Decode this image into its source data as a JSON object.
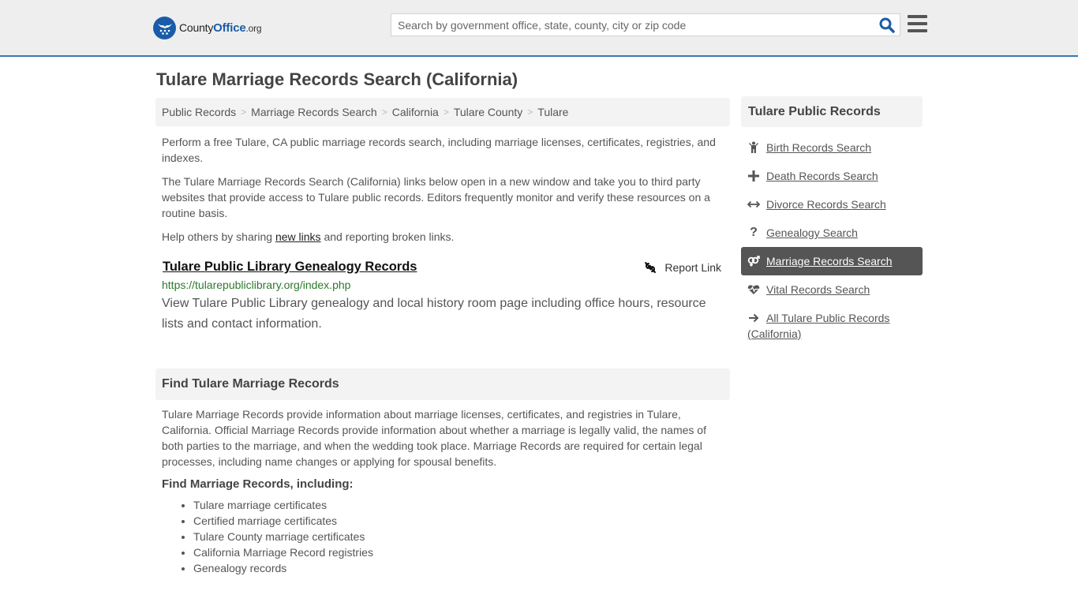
{
  "header": {
    "logo": {
      "name_main": "County",
      "name_accent": "Office",
      "tld": ".org"
    },
    "search": {
      "placeholder": "Search by government office, state, county, city or zip code",
      "value": ""
    },
    "icons": {
      "search": "search-icon",
      "menu": "hamburger-menu-icon"
    }
  },
  "page": {
    "title": "Tulare Marriage Records Search (California)"
  },
  "breadcrumb": [
    {
      "label": "Public Records"
    },
    {
      "label": "Marriage Records Search"
    },
    {
      "label": "California"
    },
    {
      "label": "Tulare County"
    },
    {
      "label": "Tulare"
    }
  ],
  "breadcrumb_separator": ">",
  "intro": {
    "p1": "Perform a free Tulare, CA public marriage records search, including marriage licenses, certificates, registries, and indexes.",
    "p2": "The Tulare Marriage Records Search (California) links below open in a new window and take you to third party websites that provide access to Tulare public records. Editors frequently monitor and verify these resources on a routine basis.",
    "p3_before": "Help others by sharing ",
    "p3_link": "new links",
    "p3_after": " and reporting broken links."
  },
  "result": {
    "title": "Tulare Public Library Genealogy Records",
    "url": "https://tularepubliclibrary.org/index.php",
    "description": "View Tulare Public Library genealogy and local history room page including office hours, resource lists and contact information.",
    "report_label": "Report Link"
  },
  "find_section": {
    "heading": "Find Tulare Marriage Records",
    "body": "Tulare Marriage Records provide information about marriage licenses, certificates, and registries in Tulare, California. Official Marriage Records provide information about whether a marriage is legally valid, the names of both parties to the marriage, and when the wedding took place. Marriage Records are required for certain legal processes, including name changes or applying for spousal benefits.",
    "subheading": "Find Marriage Records, including:",
    "items": [
      "Tulare marriage certificates",
      "Certified marriage certificates",
      "Tulare County marriage certificates",
      "California Marriage Record registries",
      "Genealogy records"
    ]
  },
  "sidebar": {
    "heading": "Tulare Public Records",
    "items": [
      {
        "label": "Birth Records Search",
        "icon": "child-icon",
        "active": false
      },
      {
        "label": "Death Records Search",
        "icon": "plus-icon",
        "active": false
      },
      {
        "label": "Divorce Records Search",
        "icon": "arrows-horizontal-icon",
        "active": false
      },
      {
        "label": "Genealogy Search",
        "icon": "question-icon",
        "active": false
      },
      {
        "label": "Marriage Records Search",
        "icon": "venus-mars-icon",
        "active": true
      },
      {
        "label": "Vital Records Search",
        "icon": "heartbeat-icon",
        "active": false
      },
      {
        "label": "All Tulare Public Records (California)",
        "icon": "arrow-right-icon",
        "active": false
      }
    ]
  },
  "colors": {
    "brand_blue": "#1a5ca8",
    "header_border": "#337ab7",
    "url_green": "#2c7a2c",
    "active_bg": "#555555"
  }
}
